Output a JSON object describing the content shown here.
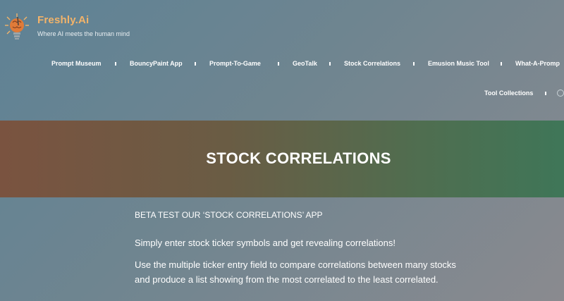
{
  "brand": {
    "name": "Freshly.Ai",
    "tagline": "Where AI meets the human mind",
    "logo_icon": "lightbulb-brain-icon",
    "accent_color": "#f2b36a"
  },
  "nav": {
    "items": [
      {
        "label": "Prompt Museum"
      },
      {
        "label": "BouncyPaint App"
      },
      {
        "label": "Prompt-To-Game"
      },
      {
        "label": "GeoTalk"
      },
      {
        "label": "Stock Correlations"
      },
      {
        "label": "Emusion Music Tool"
      },
      {
        "label": "What-A-Promp"
      }
    ],
    "row2": [
      {
        "label": "Tool Collections"
      }
    ],
    "user_icon": "user-icon"
  },
  "banner": {
    "title": "STOCK CORRELATIONS"
  },
  "content": {
    "beta": "BETA TEST OUR ‘STOCK CORRELATIONS’ APP",
    "p1": "Simply enter stock ticker symbols and get revealing correlations!",
    "p2": "Use the multiple ticker entry field to compare correlations between many stocks and produce a list showing from the most correlated to the least correlated."
  }
}
